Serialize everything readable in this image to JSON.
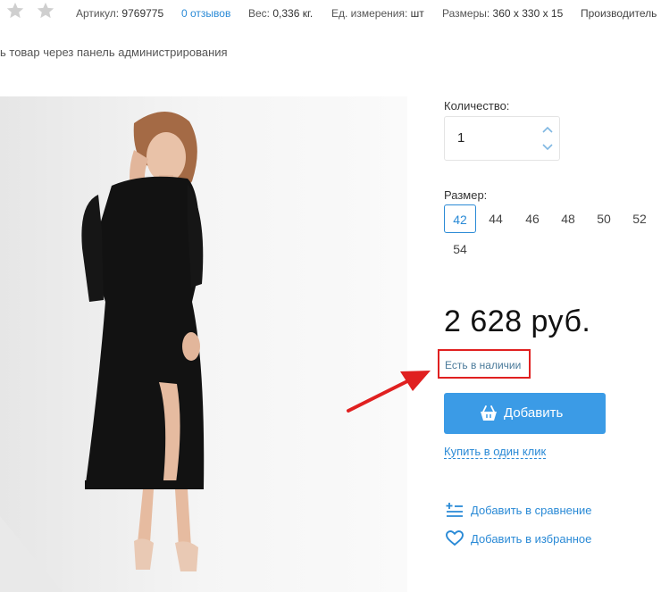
{
  "header": {
    "stars_count": 2,
    "article_label": "Артикул:",
    "article_value": "9769775",
    "reviews_link": "0 отзывов",
    "weight_label": "Вес:",
    "weight_value": "0,336 кг.",
    "unit_label": "Ед. измерения:",
    "unit_value": "шт",
    "dims_label": "Размеры:",
    "dims_value": "360 х 330 х 15",
    "manufacturer_label": "Производитель"
  },
  "admin_note": "ь товар через панель администрирования",
  "quantity": {
    "label": "Количество:",
    "value": "1"
  },
  "sizes": {
    "label": "Размер:",
    "options": [
      "42",
      "44",
      "46",
      "48",
      "50",
      "52",
      "54"
    ],
    "selected": "42"
  },
  "price": "2 628 руб.",
  "stock_status": "Есть в наличии",
  "add_button": "Добавить",
  "buy_one_click": "Купить в один клик",
  "actions": {
    "compare": "Добавить в сравнение",
    "favorites": "Добавить в избранное"
  },
  "colors": {
    "accent": "#3b9be6",
    "link": "#2a8ad6",
    "highlight": "#e02020"
  }
}
